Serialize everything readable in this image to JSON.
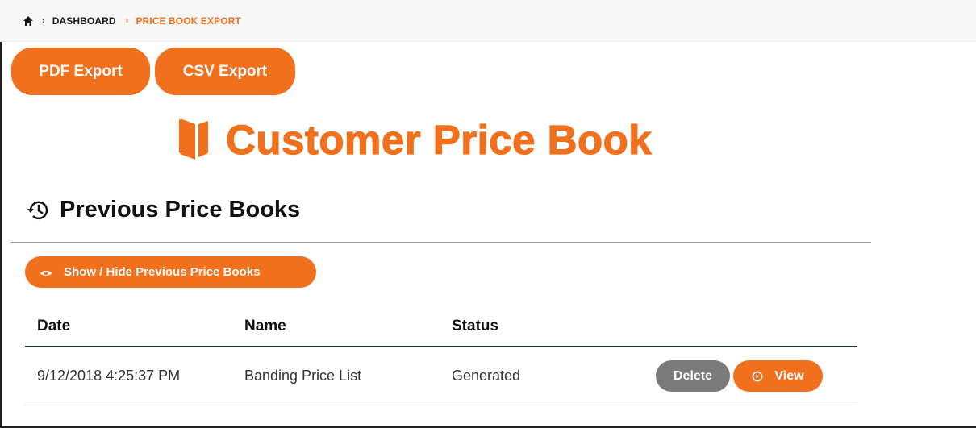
{
  "breadcrumb": {
    "home_icon": "home-icon",
    "items": [
      "DASHBOARD",
      "PRICE BOOK EXPORT"
    ]
  },
  "exports": {
    "pdf_label": "PDF Export",
    "csv_label": "CSV Export"
  },
  "title": {
    "icon": "book-icon",
    "text": "Customer Price Book"
  },
  "previous": {
    "icon": "history-icon",
    "heading": "Previous Price Books",
    "toggle_icon": "eye-icon",
    "toggle_label": "Show / Hide Previous Price Books"
  },
  "table": {
    "headers": [
      "Date",
      "Name",
      "Status"
    ],
    "rows": [
      {
        "date": "9/12/2018 4:25:37 PM",
        "name": "Banding Price List",
        "status": "Generated",
        "delete_label": "Delete",
        "view_label": "View",
        "view_icon": "circle-arrow-icon"
      }
    ]
  },
  "colors": {
    "accent": "#f0701d",
    "delete": "#7a7a7a",
    "header_rule": "#1e2a36"
  }
}
